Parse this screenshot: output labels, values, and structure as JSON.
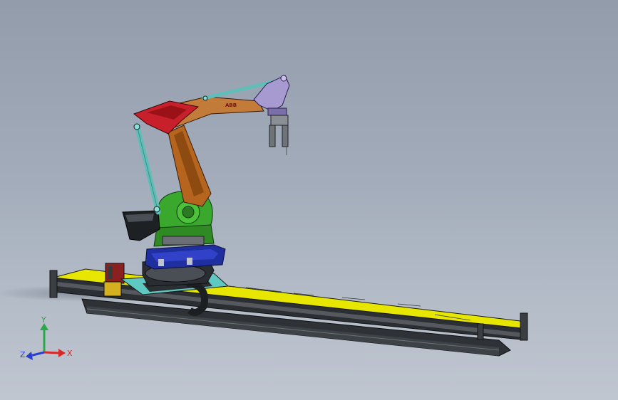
{
  "robot_logo_text": "ABB",
  "triad": {
    "x_label": "X",
    "y_label": "Y",
    "z_label": "Z",
    "x_color": "#d42a2a",
    "y_color": "#2aa84a",
    "z_color": "#2a3fd0"
  },
  "colors": {
    "background_top": "#929cab",
    "background_bottom": "#bfc6d0",
    "track_top": "#e6e600",
    "track_frame": "#2e3236",
    "base_blue": "#1f2f9f",
    "rotary_green": "#3aa82c",
    "arm_brown": "#b5651d",
    "shoulder_red": "#c8202a",
    "link_cyan": "#5fbfb8",
    "wrist_lavender": "#a79ad0",
    "gripper_grey": "#8a8f96"
  }
}
